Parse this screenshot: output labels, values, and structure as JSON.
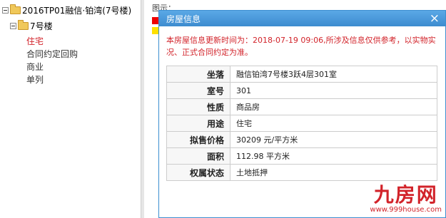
{
  "tree": {
    "root_label": "2016TP01融信·铂湾(7号楼)",
    "building_label": "7号楼",
    "items": [
      {
        "label": "住宅",
        "active": true
      },
      {
        "label": "合同约定回购",
        "active": false
      },
      {
        "label": "商业",
        "active": false
      },
      {
        "label": "单列",
        "active": false
      }
    ]
  },
  "background": {
    "legend_label": "图示："
  },
  "dialog": {
    "title": "房屋信息",
    "close_symbol": "×",
    "notice": "本房屋信息更新时间为：2018-07-19 09:06,所涉及信息仅供参考，以实物实况、正式合同约定为准。",
    "rows": [
      {
        "key": "坐落",
        "value": "融信铂湾7号楼3跃4层301室"
      },
      {
        "key": "室号",
        "value": "301"
      },
      {
        "key": "性质",
        "value": "商品房"
      },
      {
        "key": "用途",
        "value": "住宅"
      },
      {
        "key": "拟售价格",
        "value": "30209 元/平方米"
      },
      {
        "key": "面积",
        "value": "112.98 平方米"
      },
      {
        "key": "权属状态",
        "value": "土地抵押"
      }
    ]
  },
  "watermark": {
    "brand": "九房网",
    "url": "www.999house.com"
  },
  "colors": {
    "header_blue": "#3d8ccf",
    "notice_red": "#d2232a",
    "active_red": "#d2232a"
  }
}
